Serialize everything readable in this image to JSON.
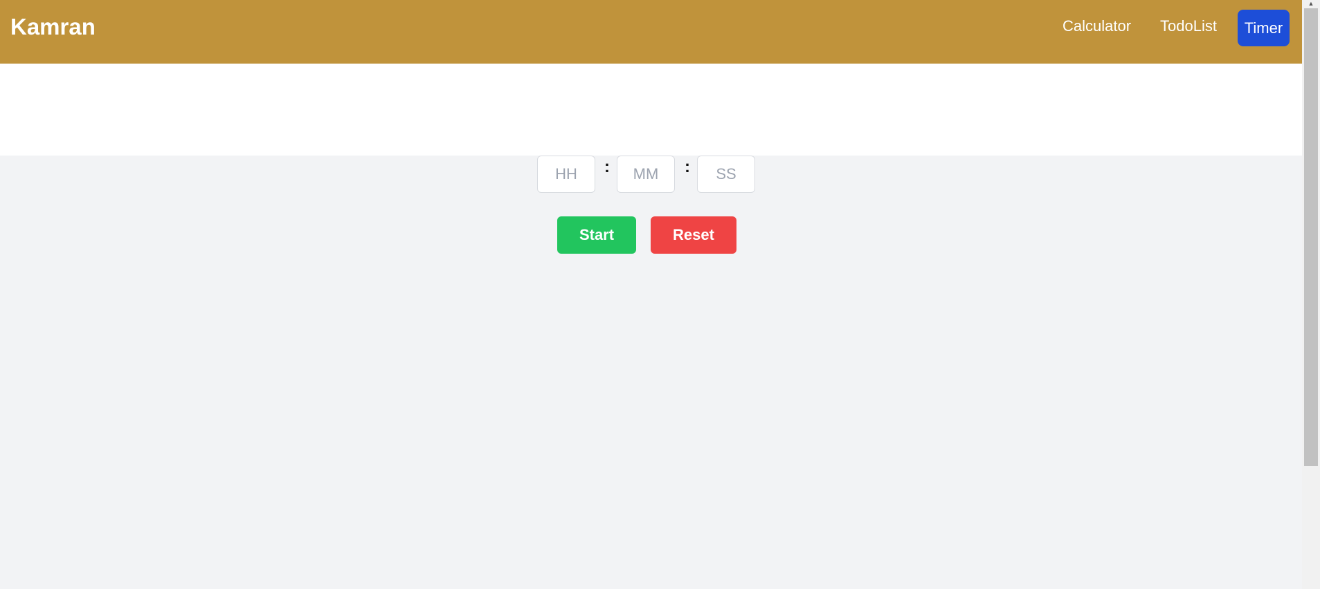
{
  "navbar": {
    "brand": "Kamran",
    "links": [
      "Calculator",
      "TodoList"
    ],
    "active_link": "Timer",
    "background_color": "#c0933b",
    "active_color": "#1d4ed8"
  },
  "timer": {
    "hours_placeholder": "HH",
    "minutes_placeholder": "MM",
    "seconds_placeholder": "SS",
    "separator": ":",
    "start_label": "Start",
    "reset_label": "Reset",
    "start_color": "#22c55e",
    "reset_color": "#ef4444"
  }
}
